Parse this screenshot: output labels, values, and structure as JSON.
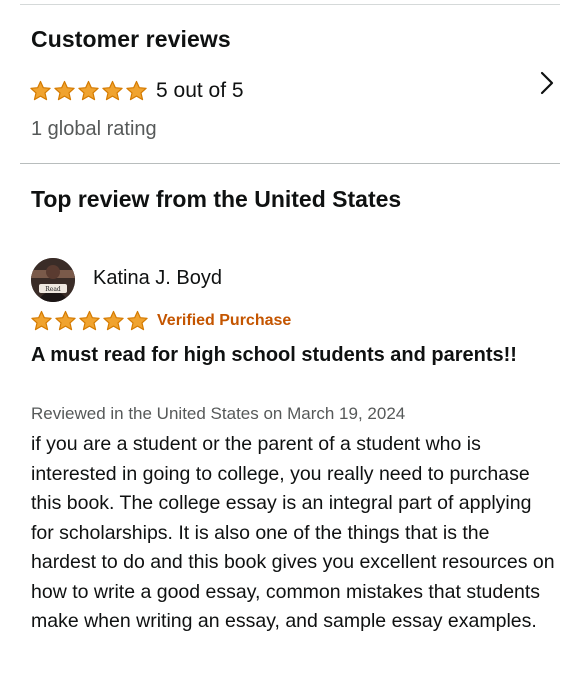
{
  "reviews_section": {
    "title": "Customer reviews",
    "rating": {
      "stars_filled": 5,
      "stars_total": 5,
      "summary_text": "5 out of 5",
      "star_color": "#f0a32f",
      "star_outline_color": "#d47a00"
    },
    "global_rating_text": "1 global rating",
    "chevron_icon": "chevron-right-icon"
  },
  "top_review": {
    "heading": "Top review from the United States",
    "reviewer": {
      "name": "Katina J. Boyd",
      "avatar_icon": "reviewer-avatar"
    },
    "stars_filled": 5,
    "verified_label": "Verified Purchase",
    "verified_color": "#c45500",
    "title": "A must read for high school students and parents!!",
    "date_text": "Reviewed in the United States on March 19, 2024",
    "body": "if you are a student or the parent of a student who is interested in going to college, you really need to purchase this book. The college essay is an integral part of applying for scholarships. It is also one of the things that is the hardest to do and this book gives you excellent resources on how to write a good essay, common mistakes that students make when writing an essay, and sample essay examples."
  }
}
